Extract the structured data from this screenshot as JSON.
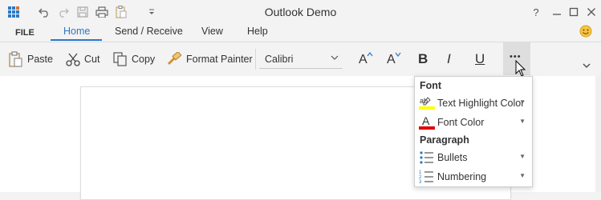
{
  "window": {
    "title": "Outlook Demo",
    "help_label": "?",
    "controls": [
      "minimize",
      "restore",
      "close"
    ]
  },
  "tabs": [
    {
      "label": "FILE"
    },
    {
      "label": "Home",
      "active": true
    },
    {
      "label": "Send / Receive"
    },
    {
      "label": "View"
    },
    {
      "label": "Help"
    }
  ],
  "ribbon": {
    "paste_label": "Paste",
    "cut_label": "Cut",
    "copy_label": "Copy",
    "format_painter_label": "Format Painter",
    "font_name": "Calibri",
    "bold_label": "B",
    "italic_label": "I",
    "underline_label": "U",
    "grow_font_label": "A",
    "shrink_font_label": "A",
    "more_label": "•••"
  },
  "overflow_menu": {
    "font_section": "Font",
    "text_highlight_label": "Text Highlight Color",
    "font_color_label": "Font Color",
    "paragraph_section": "Paragraph",
    "bullets_label": "Bullets",
    "numbering_label": "Numbering",
    "highlight_color": "#ffff00",
    "font_color": "#e00000"
  },
  "colors": {
    "accent": "#2b78c5",
    "title_bar": "#f3f3f3"
  }
}
